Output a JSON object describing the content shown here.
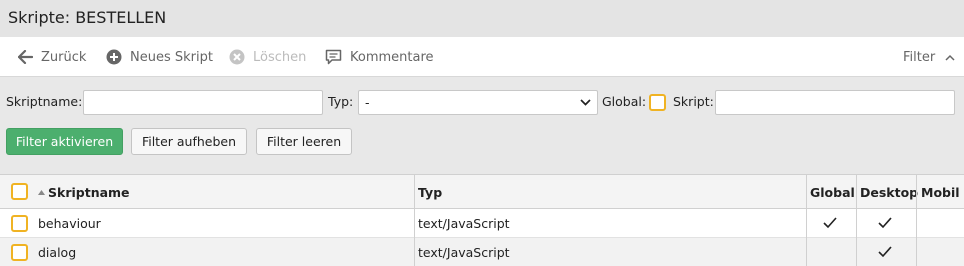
{
  "title": "Skripte: BESTELLEN",
  "toolbar": {
    "back_label": "Zurück",
    "new_label": "Neues Skript",
    "delete_label": "Löschen",
    "comments_label": "Kommentare",
    "filter_label": "Filter"
  },
  "filter": {
    "name_label": "Skriptname:",
    "name_value": "",
    "type_label": "Typ:",
    "type_value": "-",
    "global_label": "Global:",
    "script_label": "Skript:",
    "script_value": "",
    "activate_label": "Filter aktivieren",
    "cancel_label": "Filter aufheben",
    "clear_label": "Filter leeren"
  },
  "table": {
    "headers": {
      "name": "Skriptname",
      "type": "Typ",
      "global": "Global",
      "desktop": "Desktop",
      "mobile": "Mobil"
    },
    "rows": [
      {
        "name": "behaviour",
        "type": "text/JavaScript",
        "global": true,
        "desktop": true,
        "mobile": false
      },
      {
        "name": "dialog",
        "type": "text/JavaScript",
        "global": false,
        "desktop": true,
        "mobile": false
      }
    ]
  },
  "colors": {
    "primary_button": "#4caf6e",
    "checkbox_border": "#f0b323"
  }
}
